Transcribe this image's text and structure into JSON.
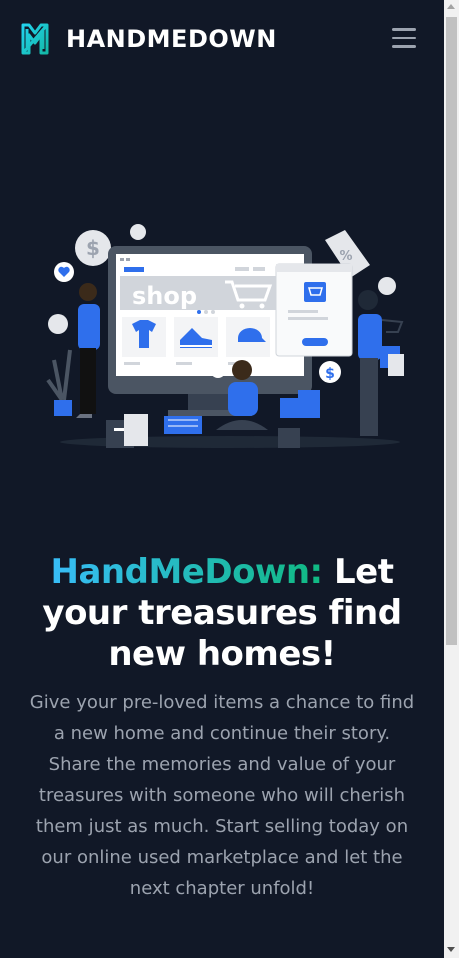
{
  "navbar": {
    "brand_name": "HANDMEDOWN",
    "logo_icon": "handmedown-logo-icon",
    "menu_icon": "hamburger-menu-icon"
  },
  "hero": {
    "illustration_shop_label": "shop",
    "headline_brand": "HandMeDown:",
    "headline_rest": " Let your treasures find new homes!",
    "description": "Give your pre-loved items a chance to find a new home and continue their story. Share the memories and value of your treasures with someone who will cherish them just as much. Start selling today on our online used marketplace and let the next chapter unfold!"
  },
  "colors": {
    "background": "#111827",
    "accent_blue": "#2f6fec",
    "gradient_start": "#38bdf8",
    "gradient_end": "#10b981",
    "text_muted": "#9ca3af"
  }
}
